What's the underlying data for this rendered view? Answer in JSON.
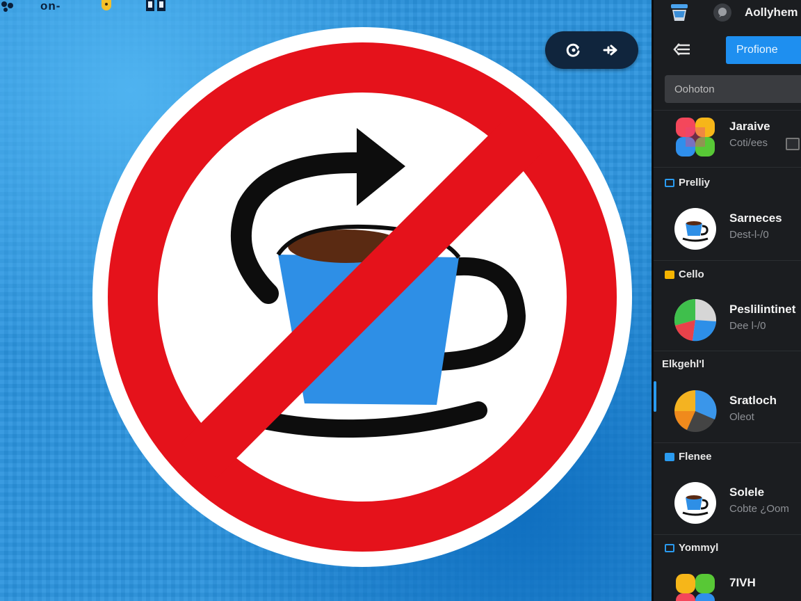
{
  "topbar": {
    "label": "on-"
  },
  "floating_controls": {
    "refresh_icon": "refresh-icon",
    "forward_icon": "forward-icon"
  },
  "sign": {
    "icon": "no-coffee-refill-sign",
    "colors": {
      "ring": "#e5121b",
      "cup": "#2e8fe6",
      "coffee": "#5a2a12",
      "arrow": "#0d0d0d",
      "background": "#ffffff"
    }
  },
  "panel": {
    "title": "Aollyhem",
    "profile_button": "Profione",
    "search_placeholder": "Oohoton",
    "items": [
      {
        "name": "Jaraive",
        "sub": "Coti/ees",
        "thumb": "color-grid-icon"
      },
      {
        "name": "Sarneces",
        "sub": "Dest-l-/0",
        "thumb": "coffee-cup-icon"
      },
      {
        "name": "Peslilintinet",
        "sub": "Dee l-/0",
        "thumb": "pie-chart-icon"
      },
      {
        "name": "Sratloch",
        "sub": "Oleot",
        "thumb": "pie-chart-icon"
      },
      {
        "name": "Solele",
        "sub": "Cobte ¿Oom",
        "thumb": "coffee-cup-icon"
      },
      {
        "name": "7IVH",
        "sub": "",
        "thumb": "color-grid-icon"
      }
    ],
    "sections": [
      "Prelliy",
      "Cello",
      "Elkgehl'l",
      "Flenee",
      "Yommyl"
    ]
  },
  "accent_color": "#1e8ff0"
}
